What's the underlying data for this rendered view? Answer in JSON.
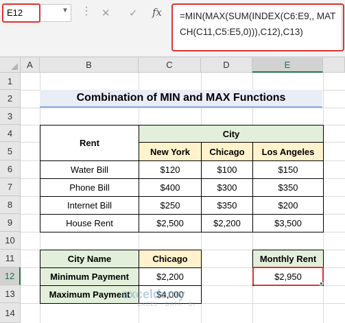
{
  "formula_bar": {
    "name_box": "E12",
    "dots": "⋮",
    "cancel_icon": "✕",
    "enter_icon": "✓",
    "fx_label": "fx",
    "formula": "=MIN(MAX(SUM(INDEX(C6:E9,, MATCH(C11,C5:E5,0))),C12),C13)"
  },
  "columns": [
    "A",
    "B",
    "C",
    "D",
    "E"
  ],
  "selected_column": "E",
  "rows": [
    "1",
    "2",
    "3",
    "4",
    "5",
    "6",
    "7",
    "8",
    "9",
    "10",
    "11",
    "12",
    "13",
    "14"
  ],
  "selected_row": "12",
  "title": "Combination of MIN and MAX Functions",
  "rent_table": {
    "rent_header": "Rent",
    "city_header": "City",
    "cities": [
      "New York",
      "Chicago",
      "Los Angeles"
    ],
    "rows": [
      {
        "label": "Water Bill",
        "values": [
          "$120",
          "$100",
          "$150"
        ]
      },
      {
        "label": "Phone Bill",
        "values": [
          "$400",
          "$300",
          "$350"
        ]
      },
      {
        "label": "Internet Bill",
        "values": [
          "$250",
          "$350",
          "$200"
        ]
      },
      {
        "label": "House Rent",
        "values": [
          "$2,500",
          "$2,200",
          "$3,500"
        ]
      }
    ]
  },
  "input_table": {
    "city_name_label": "City Name",
    "city_name_value": "Chicago",
    "min_label": "Minimum Payment",
    "min_value": "$2,200",
    "max_label": "Maximum Payment",
    "max_value": "$4,000"
  },
  "result": {
    "header": "Monthly Rent",
    "value": "$2,950"
  },
  "watermark": {
    "name": "exceldemy",
    "tagline": "EXCEL · DATA · BI"
  },
  "colors": {
    "green_header": "#e2efda",
    "yellow_header": "#fff2cc",
    "highlight_red": "#e0312f",
    "excel_green": "#217346"
  }
}
